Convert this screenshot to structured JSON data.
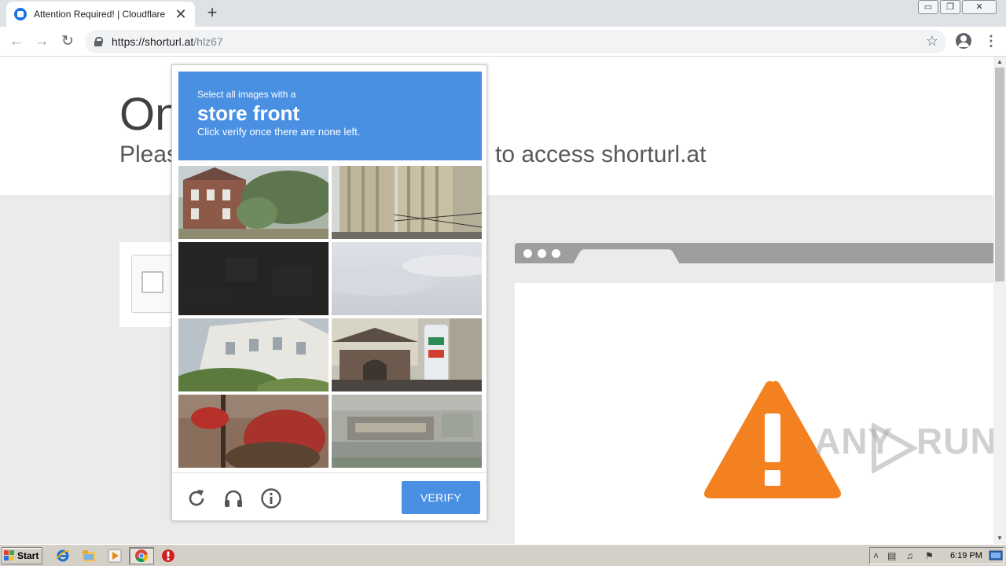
{
  "browser": {
    "tab_title": "Attention Required! | Cloudflare",
    "tab_close": "✕",
    "new_tab": "+",
    "url_scheme_host": "https://shorturl.at",
    "url_path": "/hlz67",
    "window_controls": [
      "▭",
      "❐",
      "✕"
    ]
  },
  "page": {
    "heading_partial": "On",
    "subheading_left": "Pleas",
    "subheading_right": "to access shorturl.at"
  },
  "captcha": {
    "prompt": "Select all images with a",
    "target": "store front",
    "instruction": "Click verify once there are none left.",
    "verify_label": "VERIFY",
    "tiles": [
      {
        "name": "tile-brick-house"
      },
      {
        "name": "tile-highrise-building"
      },
      {
        "name": "tile-dark-scene"
      },
      {
        "name": "tile-overcast-sky"
      },
      {
        "name": "tile-white-building"
      },
      {
        "name": "tile-shop-with-sign"
      },
      {
        "name": "tile-red-shrubs"
      },
      {
        "name": "tile-blurry-storefront"
      }
    ]
  },
  "watermark": {
    "left": "ANY",
    "right": "RUN"
  },
  "taskbar": {
    "start_label": "Start",
    "clock": "6:19 PM"
  }
}
